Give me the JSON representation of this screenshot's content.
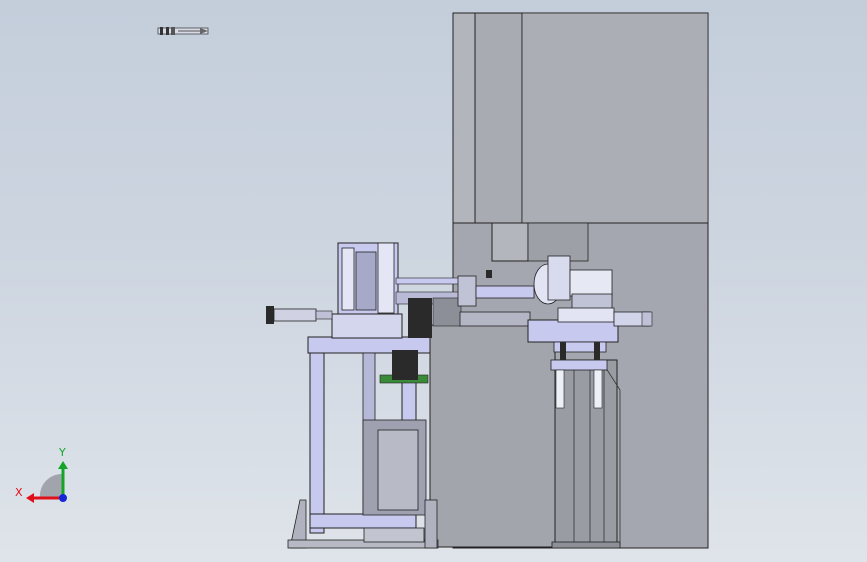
{
  "viewport": {
    "background_top": "#c4cedb",
    "background_bottom": "#dfe4ea"
  },
  "triad": {
    "x_label": "X",
    "y_label": "Y",
    "x_color": "#e0101a",
    "y_color": "#12a52a",
    "z_color": "#1626d6"
  },
  "model": {
    "body_color": "#aeb0b8",
    "frame_color": "#c7c9ef",
    "accent_green": "#3a8a3a",
    "dark_color": "#2a2a2a"
  },
  "icons": {
    "view_tool": "view-orientation-icon"
  }
}
